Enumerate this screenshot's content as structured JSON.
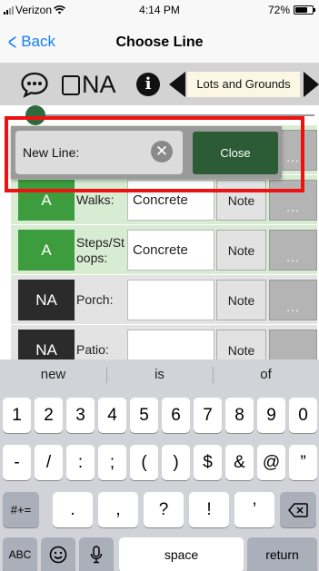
{
  "status_bar": {
    "carrier": "Verizon",
    "time": "4:14 PM",
    "battery": "72%",
    "battery_level": 0.72
  },
  "nav": {
    "back_label": "Back",
    "title": "Choose Line"
  },
  "toolbar": {
    "na_label": "NA",
    "section_label": "Lots and Grounds"
  },
  "slider": {
    "value": 0.0
  },
  "popup": {
    "field_label": "New Line:",
    "close_label": "Close"
  },
  "rows": [
    {
      "status": "",
      "label": "",
      "value": "",
      "note": "",
      "more": "..."
    },
    {
      "status": "A",
      "label": "Walks:",
      "value": "Concrete",
      "note": "Note",
      "more": "..."
    },
    {
      "status": "A",
      "label": "Steps/St oops:",
      "value": "Concrete",
      "note": "Note",
      "more": "..."
    },
    {
      "status": "NA",
      "label": "Porch:",
      "value": "",
      "note": "Note",
      "more": "..."
    },
    {
      "status": "NA",
      "label": "Patio:",
      "value": "",
      "note": "Note",
      "more": ""
    }
  ],
  "keyboard": {
    "suggestions": [
      "new",
      "is",
      "of"
    ],
    "row1": [
      "1",
      "2",
      "3",
      "4",
      "5",
      "6",
      "7",
      "8",
      "9",
      "0"
    ],
    "row2": [
      "-",
      "/",
      ":",
      ";",
      "(",
      ")",
      "$",
      "&",
      "@",
      "”"
    ],
    "row3_left": "#+=",
    "row3": [
      ".",
      ",",
      "?",
      "!",
      "’"
    ],
    "abc": "ABC",
    "space": "space",
    "return": "return"
  }
}
